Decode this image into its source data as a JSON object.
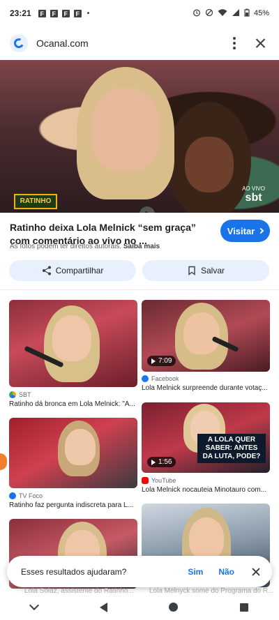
{
  "status_bar": {
    "time": "23:21",
    "notif_icons": [
      "F",
      "F",
      "F",
      "F"
    ],
    "dot": "•",
    "battery": "45%"
  },
  "header": {
    "site_name": "Ocanal.com"
  },
  "hero": {
    "show_logo": "RATINHO",
    "live_top": "AO VIVO",
    "live_brand": "sbt"
  },
  "result": {
    "title": "Ratinho deixa Lola Melnick “sem graça” com comentário ao vivo no ...",
    "visit_label": "Visitar",
    "copyright_note": "As fotos podem ter direitos autorais.",
    "learn_more": "Saiba mais"
  },
  "actions": {
    "share_label": "Compartilhar",
    "save_label": "Salvar"
  },
  "grid": [
    {
      "source": "SBT",
      "source_color": "#e8a317",
      "caption": "Ratinho dá bronca em Lola Melnick: \"A...",
      "duration": ""
    },
    {
      "source": "Facebook",
      "source_color": "#1877f2",
      "caption": "Lola Melnick surpreende durante votaç...",
      "duration": "7:09"
    },
    {
      "source": "TV Foco",
      "source_color": "#1a73e8",
      "caption": "Ratinho faz pergunta indiscreta para L...",
      "duration": ""
    },
    {
      "source": "YouTube",
      "source_color": "#ff0000",
      "caption": "Lola Melnick nocauteia Minotauro com...",
      "duration": "1:56",
      "overlay": "A LOLA QUER SABER: ANTES DA LUTA, PODE?"
    }
  ],
  "bottom_faded": {
    "left": "Lola Solaz, assistente do Ratinho...",
    "right": "Lola Melnyck some do Programa do R..."
  },
  "feedback": {
    "question": "Esses resultados ajudaram?",
    "yes": "Sim",
    "no": "Não"
  }
}
